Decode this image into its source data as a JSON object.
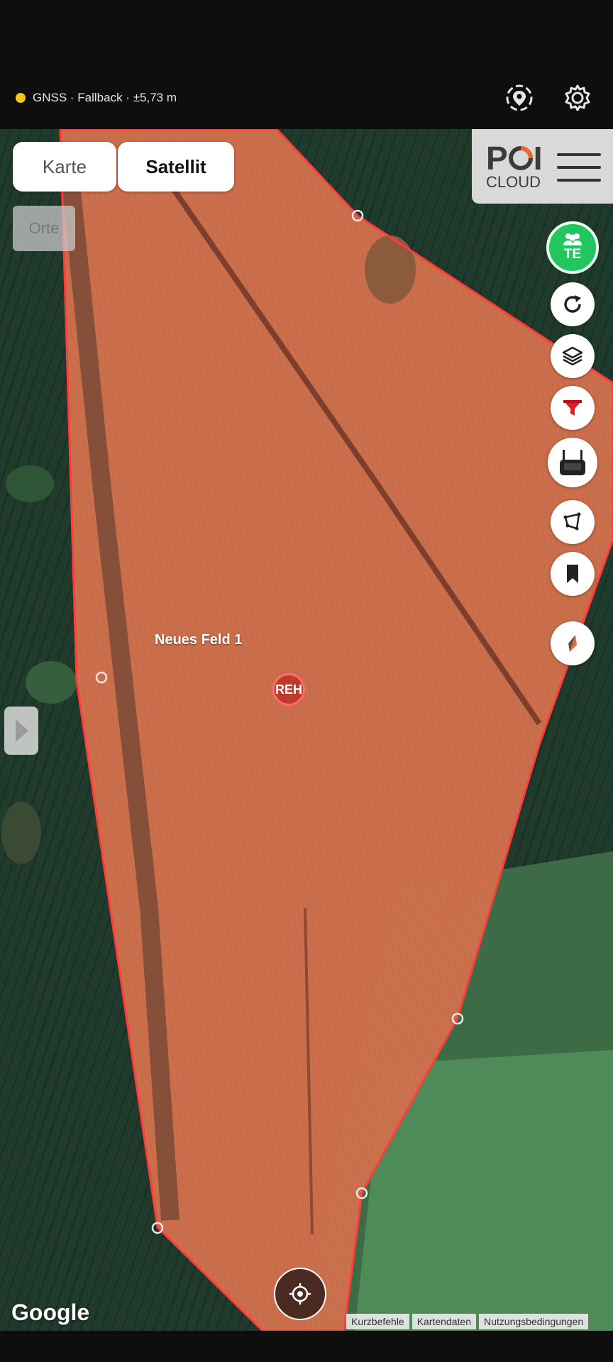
{
  "status": {
    "gnss_text": "GNSS · Fallback · ±5,73 m",
    "gnss_dot_color": "#f5c518",
    "location_icon": "location-pin-icon",
    "settings_icon": "gear-icon"
  },
  "map": {
    "type_tabs": [
      {
        "label": "Karte",
        "selected": false
      },
      {
        "label": "Satellit",
        "selected": true
      }
    ],
    "places_button": "Orte",
    "field_label": "Neues Feld 1",
    "poi_marker": "REH",
    "field_color": "#e0704a",
    "field_outline_color": "#ff3b3b",
    "google_label": "Google",
    "attribution": [
      "Kurzbefehle",
      "Kartendaten",
      "Nutzungsbedingungen"
    ]
  },
  "brand": {
    "logo_line1_a": "P",
    "logo_line1_b": "I",
    "logo_line2": "CLOUD"
  },
  "toolbar": {
    "team_label": "TE",
    "team_color": "#22c55e",
    "filter_color": "#e11d2a",
    "buttons": [
      "refresh-icon",
      "layers-icon",
      "filter-icon",
      "remote-controller-icon",
      "polygon-draw-icon",
      "bookmark-icon",
      "compass-icon"
    ]
  }
}
